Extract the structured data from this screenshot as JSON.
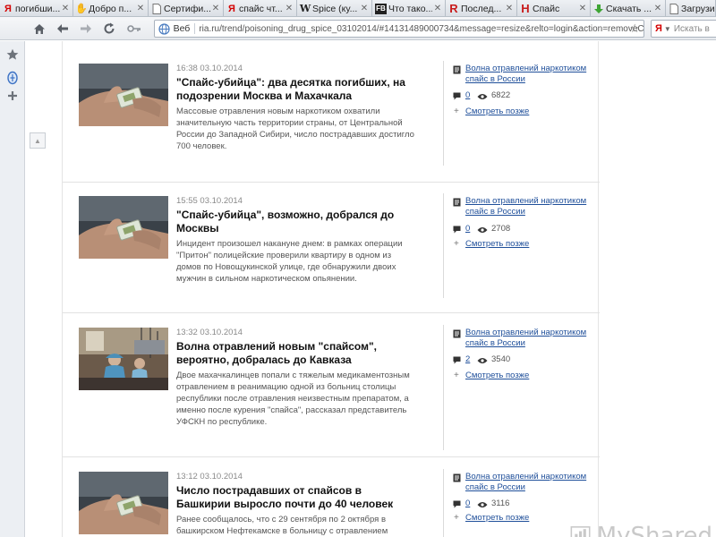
{
  "browser": {
    "tabs": [
      {
        "favicon": "yandex-icon",
        "title": "погибши..."
      },
      {
        "favicon": "hand-icon",
        "title": "Добро п..."
      },
      {
        "favicon": "page-icon",
        "title": "Сертифи..."
      },
      {
        "favicon": "yandex-icon",
        "title": "спайс чт..."
      },
      {
        "favicon": "wikipedia-icon",
        "title": "Spice (ку..."
      },
      {
        "favicon": "fb-icon",
        "title": "Что тако..."
      },
      {
        "favicon": "r-icon",
        "title": "Послед..."
      },
      {
        "favicon": "h-icon",
        "title": "Спайс"
      },
      {
        "favicon": "download-icon",
        "title": "Скачать ..."
      },
      {
        "favicon": "page-icon",
        "title": "Загрузи..."
      }
    ],
    "omnibox": {
      "scope_label": "Веб",
      "url": "ria.ru/trend/poisoning_drug_spice_03102014/#14131489000734&message=resize&relto=login&action=removeClas"
    },
    "search": {
      "placeholder": "Искать в"
    }
  },
  "articles": [
    {
      "time": "16:38 03.10.2014",
      "title": "\"Спайс-убийца\": два десятка погибших, на подозрении Москва и Махачкала",
      "summary": "Массовые отравления новым наркотиком охватили значительную часть территории страны, от Центральной России до Западной Сибири, число пострадавших достигло 700 человек.",
      "trend_link": "Волна отравлений наркотиком спайс в России",
      "comments": "0",
      "views": "6822",
      "watch_later": "Смотреть позже",
      "image": "hand-drug-packet"
    },
    {
      "time": "15:55 03.10.2014",
      "title": "\"Спайс-убийца\", возможно, добрался до Москвы",
      "summary": "Инцидент произошел накануне днем: в рамках операции \"Притон\" полицейские проверили квартиру в одном из домов по Новощукинской улице, где обнаружили двоих мужчин в сильном наркотическом опьянении.",
      "trend_link": "Волна отравлений наркотиком спайс в России",
      "comments": "0",
      "views": "2708",
      "watch_later": "Смотреть позже",
      "image": "hand-drug-packet"
    },
    {
      "time": "13:32 03.10.2014",
      "title": "Волна отравлений новым \"спайсом\", вероятно, добралась до Кавказа",
      "summary": "Двое махачкалинцев попали с тяжелым медикаментозным отравлением в реанимацию одной из больниц столицы республики после отравления неизвестным препаратом, а именно после курения \"спайса\", рассказал представитель УФСКН по республике.",
      "trend_link": "Волна отравлений наркотиком спайс в России",
      "comments": "2",
      "views": "3540",
      "watch_later": "Смотреть позже",
      "image": "hospital-staff"
    },
    {
      "time": "13:12 03.10.2014",
      "title": "Число пострадавших от спайсов в Башкирии выросло почти до 40 человек",
      "summary": "Ранее сообщалось, что с 29 сентября по 2 октября в башкирском Нефтекамске в больницу с отравлением неясной",
      "trend_link": "Волна отравлений наркотиком спайс в России",
      "comments": "0",
      "views": "3116",
      "watch_later": "Смотреть позже",
      "image": "hand-drug-packet"
    }
  ],
  "watermark": {
    "text": "MyShared"
  },
  "colors": {
    "link": "#1f4f9a",
    "title": "#111111",
    "meta": "#8a8a8a",
    "yandex_red": "#d40000"
  }
}
